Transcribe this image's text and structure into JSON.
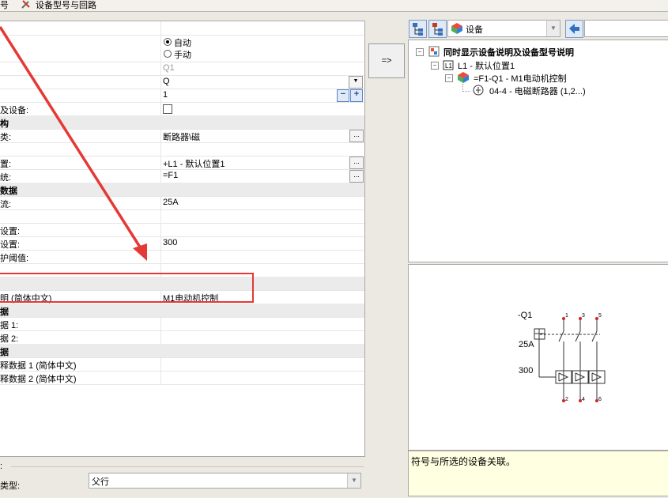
{
  "topbar": {
    "left_fragment": "号",
    "tool_label": "设备型号与回路"
  },
  "grid": {
    "rows": [
      {
        "label": "",
        "kind": "plain"
      },
      {
        "label": "",
        "kind": "radio-auto"
      },
      {
        "label": "",
        "value": "Q1",
        "kind": "plain-dim"
      },
      {
        "label": "",
        "value": "Q",
        "kind": "dropdown"
      },
      {
        "label": "",
        "value": "1",
        "kind": "stepper"
      },
      {
        "label": "及设备:",
        "kind": "checkbox"
      },
      {
        "label": "构",
        "kind": "cat"
      },
      {
        "label": "类:",
        "value": "断路器\\磁",
        "kind": "dots"
      },
      {
        "label": "",
        "kind": "plain"
      },
      {
        "label": "置:",
        "value": "+L1 - 默认位置1",
        "kind": "dots"
      },
      {
        "label": "统:",
        "value": "=F1",
        "kind": "dots"
      },
      {
        "label": "数据",
        "kind": "cat"
      },
      {
        "label": "流:",
        "value": "25A",
        "kind": "plain"
      },
      {
        "label": "",
        "kind": "plain"
      },
      {
        "label": "设置:",
        "kind": "plain"
      },
      {
        "label": "设置:",
        "value": "300",
        "kind": "plain"
      },
      {
        "label": "护阈值:",
        "kind": "plain"
      },
      {
        "label": "",
        "kind": "plain"
      },
      {
        "label": "",
        "kind": "cat"
      },
      {
        "label": "明 (简体中文)",
        "value": "M1电动机控制",
        "kind": "plain"
      },
      {
        "label": "据",
        "kind": "cat"
      },
      {
        "label": "据 1:",
        "kind": "plain"
      },
      {
        "label": "据 2:",
        "kind": "plain"
      },
      {
        "label": "据",
        "kind": "cat"
      },
      {
        "label": "释数据 1 (简体中文)",
        "kind": "plain"
      },
      {
        "label": "释数据 2 (简体中文)",
        "kind": "plain"
      }
    ],
    "radio_auto": "自动",
    "radio_manual": "手动"
  },
  "bottom": {
    "group_label": ":",
    "type_label": "类型:",
    "type_value": "父行"
  },
  "transfer_button": "=>",
  "tree_toolbar": {
    "combo_value": "设备",
    "search_value": ""
  },
  "tree": {
    "root": "同时显示设备说明及设备型号说明",
    "level1": "L1 - 默认位置1",
    "level2": "=F1-Q1 - M1电动机控制",
    "level3": "04-4 - 电磁断路器 (1,2...)"
  },
  "preview": {
    "tag": "-Q1",
    "current": "25A",
    "setting": "300",
    "top_pins": [
      "1",
      "3",
      "5"
    ],
    "bottom_pins": [
      "2",
      "4",
      "6"
    ]
  },
  "description": "符号与所选的设备关联。",
  "colors": {
    "annotation_red": "#e53935",
    "selection_box": "#e53935",
    "tooltip_bg": "#ffffe1"
  }
}
